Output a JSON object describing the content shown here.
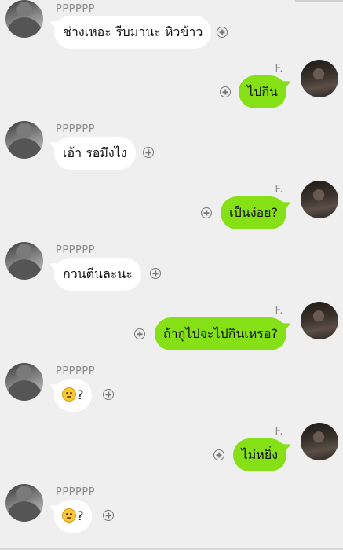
{
  "contacts": {
    "left_name": "PPPPPP",
    "right_name": "F."
  },
  "messages": [
    {
      "side": "left",
      "text": "ช่างเหอะ รีบมานะ หิวข้าว"
    },
    {
      "side": "right",
      "text": "ไปกิน"
    },
    {
      "side": "left",
      "text": "เอ้า รอมึงไง"
    },
    {
      "side": "right",
      "text": "เป็นง่อย?"
    },
    {
      "side": "left",
      "text": "กวนตีนละนะ"
    },
    {
      "side": "right",
      "text": "ถ้ากูไปจะไปกินเหรอ?"
    },
    {
      "side": "left",
      "text": "?",
      "emoji": "confused-face"
    },
    {
      "side": "right",
      "text": "ไม่หยิ่ง"
    },
    {
      "side": "left",
      "text": "?",
      "emoji": "confused-face"
    }
  ],
  "colors": {
    "background": "#efefef",
    "outgoing_bubble": "#85e016",
    "incoming_bubble": "#ffffff"
  }
}
